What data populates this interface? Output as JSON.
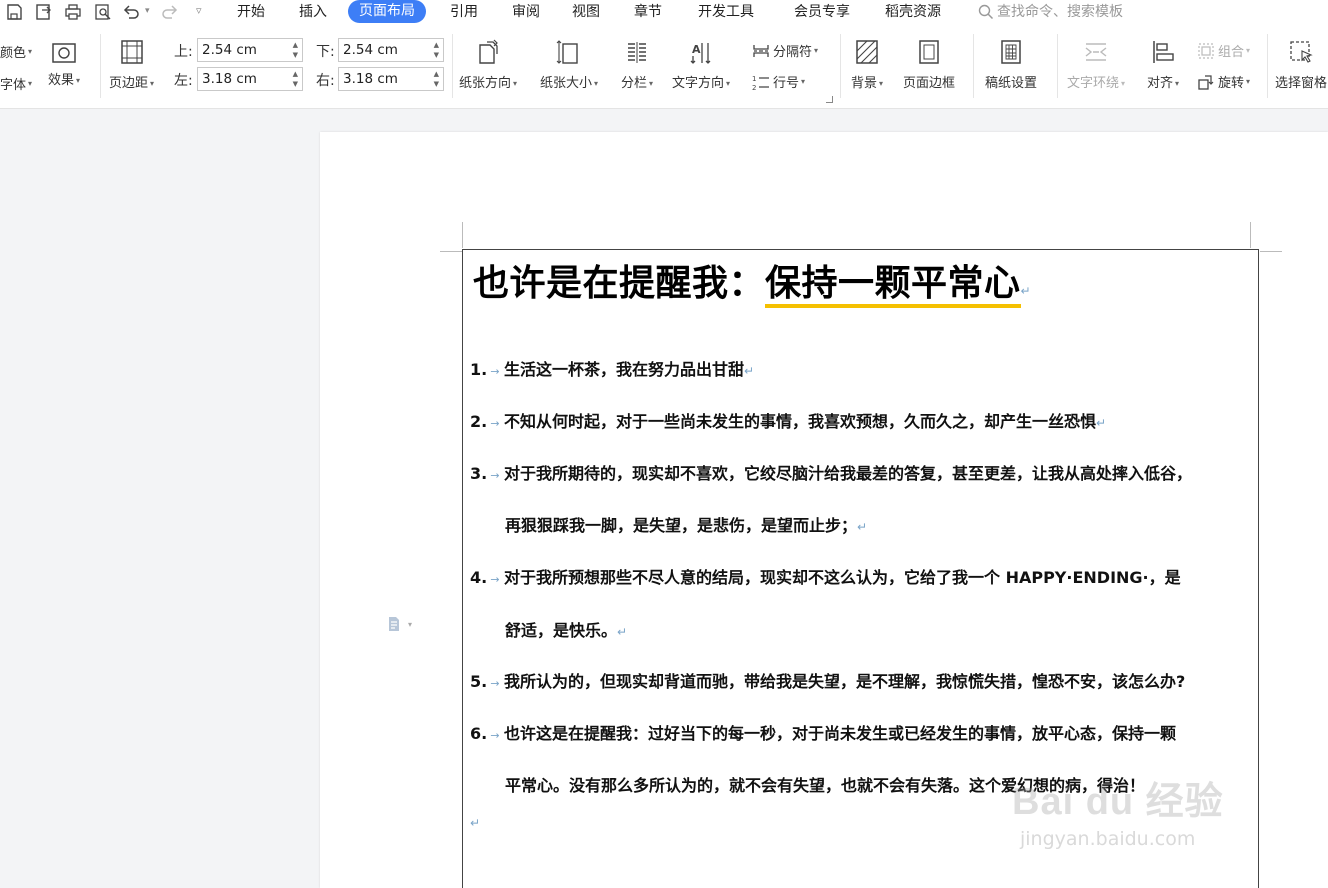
{
  "menu": {
    "tabs": [
      "开始",
      "插入",
      "页面布局",
      "引用",
      "审阅",
      "视图",
      "章节",
      "开发工具",
      "会员专享",
      "稻壳资源"
    ],
    "active_tab": "页面布局",
    "search_placeholder": "查找命令、搜索模板"
  },
  "ribbon": {
    "color_label": "颜色",
    "font_label": "字体",
    "effect_label": "效果",
    "margins_label": "页边距",
    "margin_top_label": "上:",
    "margin_top_value": "2.54 cm",
    "margin_bottom_label": "下:",
    "margin_bottom_value": "2.54 cm",
    "margin_left_label": "左:",
    "margin_left_value": "3.18 cm",
    "margin_right_label": "右:",
    "margin_right_value": "3.18 cm",
    "orientation_label": "纸张方向",
    "size_label": "纸张大小",
    "columns_label": "分栏",
    "text_direction_label": "文字方向",
    "break_label": "分隔符",
    "line_number_label": "行号",
    "background_label": "背景",
    "page_border_label": "页面边框",
    "grid_paper_label": "稿纸设置",
    "text_wrap_label": "文字环绕",
    "align_label": "对齐",
    "group_label": "组合",
    "rotate_label": "旋转",
    "select_pane_label": "选择窗格"
  },
  "document": {
    "title_plain": "也许是在提醒我：",
    "title_highlight": "保持一颗平常心",
    "items": [
      {
        "num": "1.",
        "lines": [
          "生活这一杯茶，我在努力品出甘甜"
        ]
      },
      {
        "num": "2.",
        "lines": [
          "不知从何时起，对于一些尚未发生的事情，我喜欢预想，久而久之，却产生一丝恐惧"
        ]
      },
      {
        "num": "3.",
        "lines": [
          "对于我所期待的，现实却不喜欢，它绞尽脑汁给我最差的答复，甚至更差，让我从高处摔入低谷，",
          "再狠狠踩我一脚，是失望，是悲伤，是望而止步；"
        ]
      },
      {
        "num": "4.",
        "lines": [
          "对于我所预想那些不尽人意的结局，现实却不这么认为，它给了我一个 HAPPY·ENDING·，是",
          "舒适，是快乐。"
        ]
      },
      {
        "num": "5.",
        "lines": [
          "我所认为的，但现实却背道而驰，带给我是失望，是不理解，我惊慌失措，惶恐不安，该怎么办?"
        ]
      },
      {
        "num": "6.",
        "lines": [
          "也许这是在提醒我：过好当下的每一秒，对于尚未发生或已经发生的事情，放平心态，保持一颗",
          "平常心。没有那么多所认为的，就不会有失望，也就不会有失落。这个爱幻想的病，得治！"
        ]
      }
    ],
    "paragraph_mark": "↵",
    "tab_mark": "→"
  },
  "watermark": {
    "brand": "Bai du 经验",
    "url": "jingyan.baidu.com"
  },
  "colors": {
    "active_tab_bg": "#3d7ef6",
    "title_underline": "#f5c000",
    "format_mark": "#7aa4c8"
  }
}
